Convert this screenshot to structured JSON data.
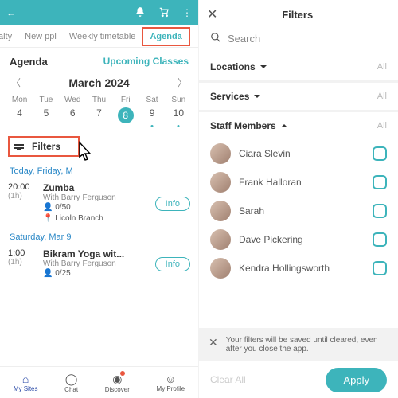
{
  "left": {
    "tabs": {
      "t0": "alty",
      "t1": "New ppl",
      "t2": "Weekly timetable",
      "t3": "Agenda"
    },
    "subhead": {
      "title": "Agenda",
      "upcoming": "Upcoming Classes"
    },
    "month": "March 2024",
    "dow": {
      "d0": "Mon",
      "d1": "Tue",
      "d2": "Wed",
      "d3": "Thu",
      "d4": "Fri",
      "d5": "Sat",
      "d6": "Sun"
    },
    "days": {
      "n0": "4",
      "n1": "5",
      "n2": "6",
      "n3": "7",
      "n4": "8",
      "n5": "9",
      "n6": "10"
    },
    "filters_label": "Filters",
    "today_label": "Today, Friday, M",
    "class1": {
      "time": "20:00",
      "dur": "(1h)",
      "name": "Zumba",
      "with": "With Barry Ferguson",
      "cap": "0/50",
      "loc": "Licoln Branch",
      "info": "Info"
    },
    "day2_label": "Saturday, Mar 9",
    "class2": {
      "time": "1:00",
      "dur": "(1h)",
      "name": "Bikram Yoga wit...",
      "with": "With Barry Ferguson",
      "cap": "0/25",
      "info": "Info"
    },
    "nav": {
      "n0": "My Sites",
      "n1": "Chat",
      "n2": "Discover",
      "n3": "My Profile"
    }
  },
  "right": {
    "title": "Filters",
    "search_placeholder": "Search",
    "sections": {
      "loc": "Locations",
      "svc": "Services",
      "staff": "Staff Members",
      "all": "All"
    },
    "members": {
      "m0": "Ciara Slevin",
      "m1": "Frank Halloran",
      "m2": "Sarah",
      "m3": "Dave Pickering",
      "m4": "Kendra Hollingsworth"
    },
    "toast": "Your filters will be saved until cleared, even after you close the app.",
    "clear": "Clear All",
    "apply": "Apply"
  }
}
